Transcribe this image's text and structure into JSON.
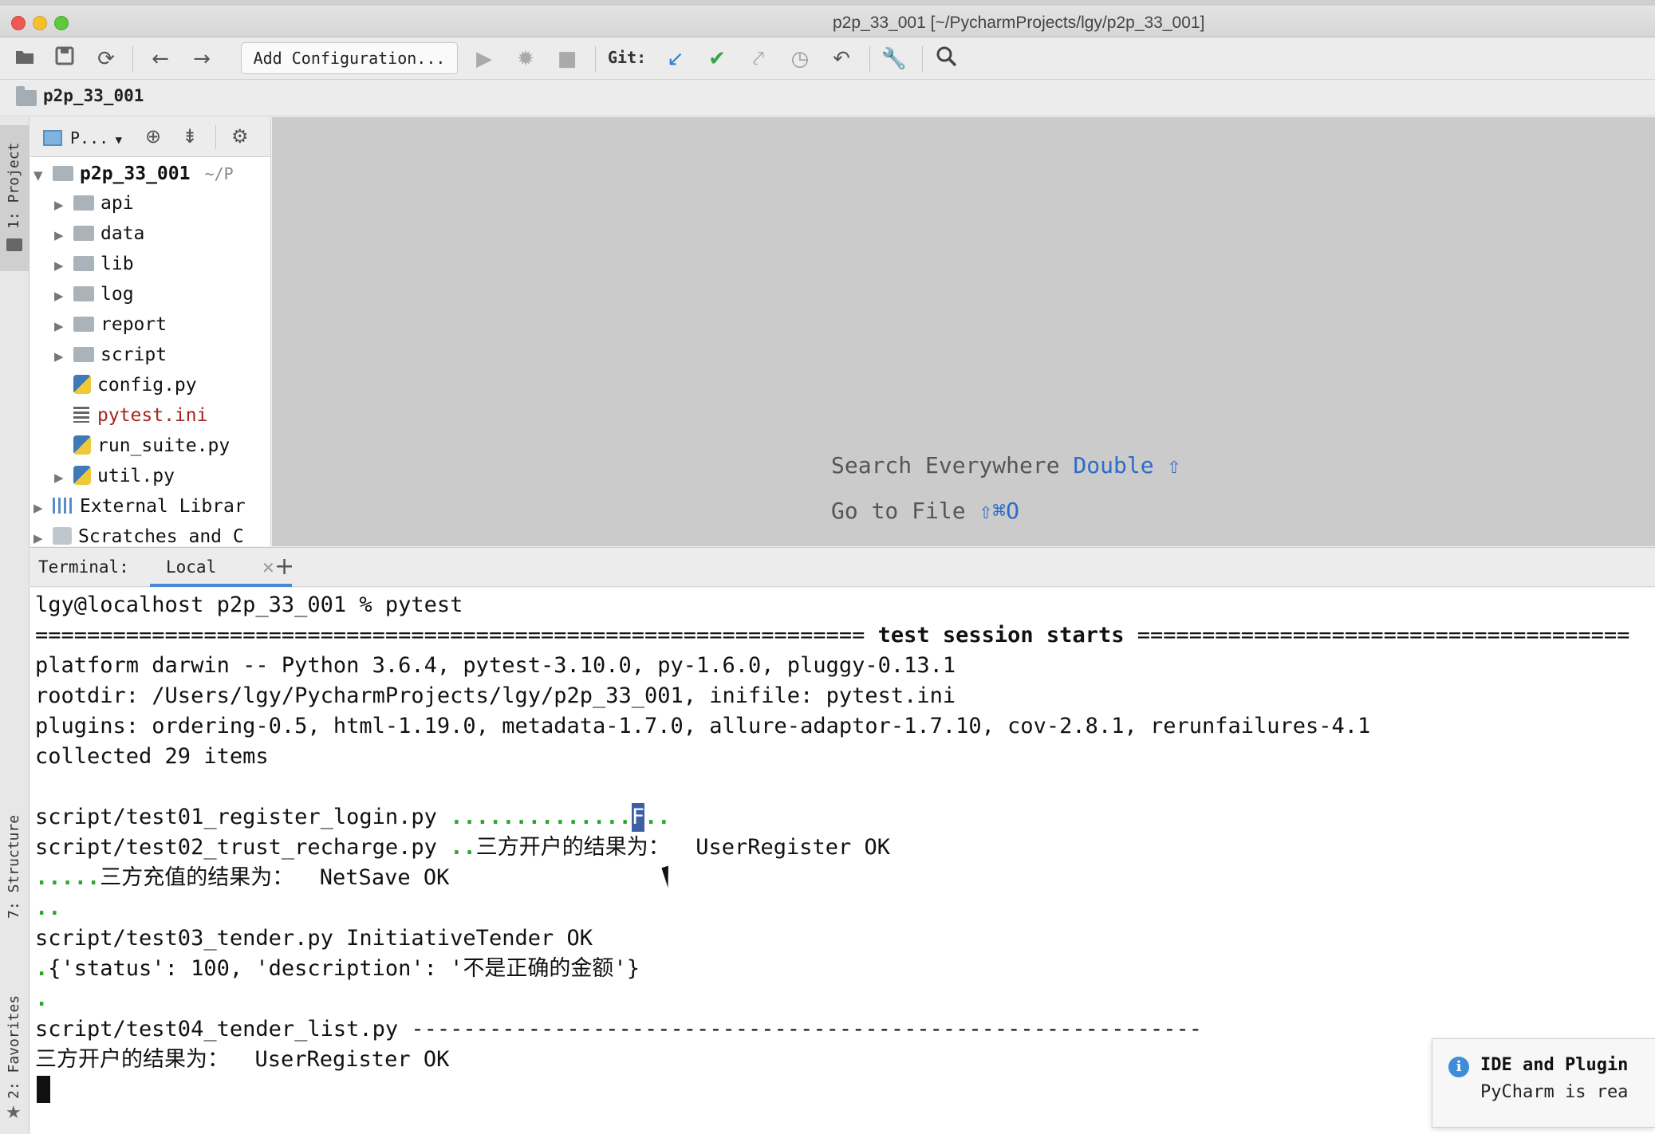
{
  "window": {
    "title": "p2p_33_001 [~/PycharmProjects/lgy/p2p_33_001]"
  },
  "toolbar": {
    "add_configuration_label": "Add Configuration...",
    "git_label": "Git:",
    "icons": [
      "open-folder-icon",
      "save-icon",
      "sync-icon",
      "back-arrow-icon",
      "forward-arrow-icon",
      "run-icon",
      "debug-icon",
      "stop-icon",
      "git-update-icon",
      "git-commit-icon",
      "git-push-icon",
      "history-icon",
      "revert-icon",
      "wrench-icon",
      "search-icon"
    ]
  },
  "navbar": {
    "project": "p2p_33_001"
  },
  "side_tabs": {
    "project": "1: Project",
    "structure": "7: Structure",
    "favorites": "2: Favorites"
  },
  "project_panel": {
    "dropdown_label": "P...",
    "root": {
      "name": "p2p_33_001",
      "path": "~/P"
    },
    "items": [
      {
        "label": "api",
        "type": "folder"
      },
      {
        "label": "data",
        "type": "folder"
      },
      {
        "label": "lib",
        "type": "folder"
      },
      {
        "label": "log",
        "type": "folder"
      },
      {
        "label": "report",
        "type": "folder"
      },
      {
        "label": "script",
        "type": "folder"
      },
      {
        "label": "config.py",
        "type": "python"
      },
      {
        "label": "pytest.ini",
        "type": "ini"
      },
      {
        "label": "run_suite.py",
        "type": "python"
      },
      {
        "label": "util.py",
        "type": "python"
      }
    ],
    "external_libraries": "External Librar",
    "scratches": "Scratches and C"
  },
  "editor_hints": {
    "search_everywhere": "Search Everywhere",
    "search_everywhere_key": "Double ⇧",
    "go_to_file": "Go to File",
    "go_to_file_key": "⇧⌘O"
  },
  "terminal": {
    "label": "Terminal:",
    "tab": "Local",
    "lines": {
      "prompt": "lgy@localhost p2p_33_001 % pytest",
      "session_rule_left": "================================================================",
      "session_title": "test session starts",
      "session_rule_right": "======================================",
      "platform": "platform darwin -- Python 3.6.4, pytest-3.10.0, py-1.6.0, pluggy-0.13.1",
      "rootdir": "rootdir: /Users/lgy/PycharmProjects/lgy/p2p_33_001, inifile: pytest.ini",
      "plugins": "plugins: ordering-0.5, html-1.19.0, metadata-1.7.0, allure-adaptor-1.7.10, cov-2.8.1, rerunfailures-4.1",
      "collected": "collected 29 items",
      "t01_file": "script/test01_register_login.py",
      "t01_dots_a": "..............",
      "t01_fail": "F",
      "t01_dots_b": "..",
      "t02_file": "script/test02_trust_recharge.py",
      "t02_dots": "..",
      "t02_msg": "三方开户的结果为：  UserRegister OK",
      "t02b_dots": ".....",
      "t02b_msg": "三方充值的结果为：  NetSave OK",
      "t02c_dots": "..",
      "t03": "script/test03_tender.py InitiativeTender OK",
      "t03b_dot": ".",
      "t03b_msg": "{'status': 100, 'description': '不是正确的金额'}",
      "t03c_dot": ".",
      "t04": "script/test04_tender_list.py -------------------------------------------------------------",
      "t04_msg": "三方开户的结果为：  UserRegister OK"
    }
  },
  "notification": {
    "title": "IDE and Plugin",
    "body": "PyCharm is rea"
  }
}
